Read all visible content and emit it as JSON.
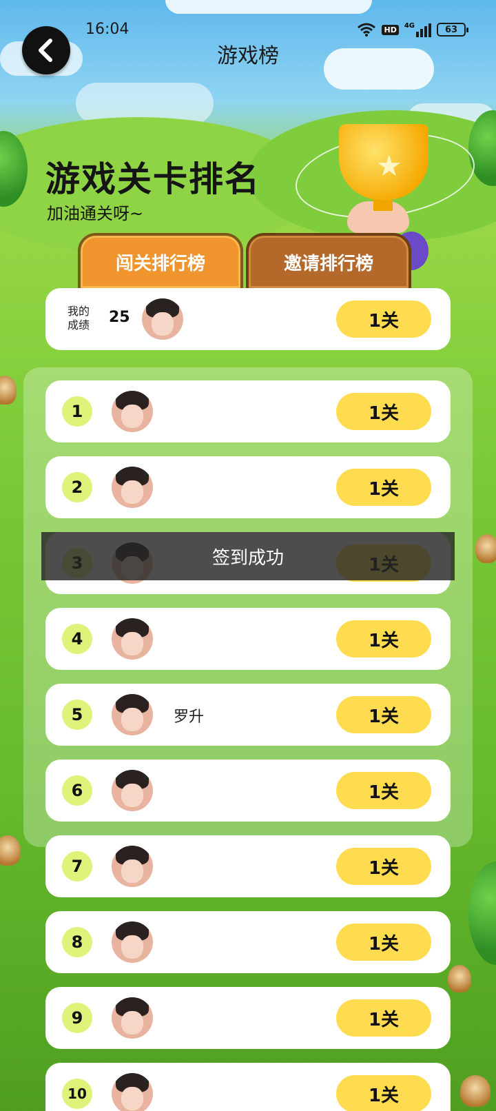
{
  "status_bar": {
    "time": "16:04",
    "network": "4G",
    "hd": "HD",
    "battery": "63"
  },
  "header": {
    "title": "游戏榜"
  },
  "hero": {
    "title": "游戏关卡排名",
    "subtitle": "加油通关呀~"
  },
  "tabs": [
    {
      "label": "闯关排行榜",
      "active": true
    },
    {
      "label": "邀请排行榜",
      "active": false
    }
  ],
  "my_result": {
    "label": "我的成绩",
    "score": "25",
    "level": "1关"
  },
  "rankings": [
    {
      "rank": "1",
      "name": "",
      "level": "1关"
    },
    {
      "rank": "2",
      "name": "",
      "level": "1关"
    },
    {
      "rank": "3",
      "name": "",
      "level": "1关"
    },
    {
      "rank": "4",
      "name": "",
      "level": "1关"
    },
    {
      "rank": "5",
      "name": "罗升",
      "level": "1关"
    },
    {
      "rank": "6",
      "name": "",
      "level": "1关"
    },
    {
      "rank": "7",
      "name": "",
      "level": "1关"
    },
    {
      "rank": "8",
      "name": "",
      "level": "1关"
    },
    {
      "rank": "9",
      "name": "",
      "level": "1关"
    },
    {
      "rank": "10",
      "name": "",
      "level": "1关"
    }
  ],
  "toast": {
    "message": "签到成功"
  },
  "colors": {
    "tab_active": "#f0952e",
    "tab_inactive": "#b4682a",
    "level_pill": "#ffdc4f",
    "rank_badge": "#dff37a"
  }
}
